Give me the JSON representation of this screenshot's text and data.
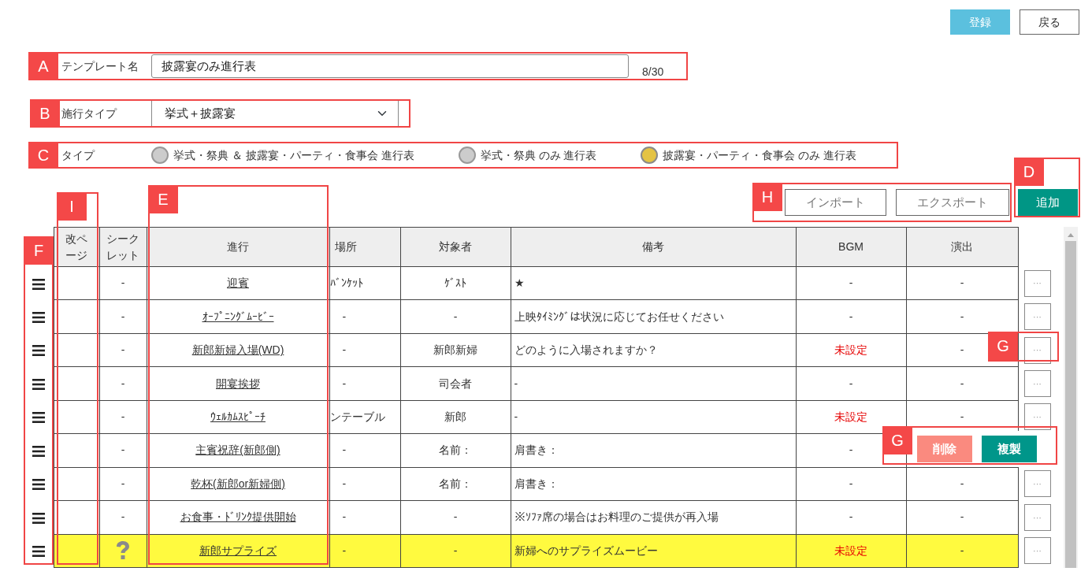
{
  "header_buttons": [
    {
      "label": "登録",
      "kind": "primary"
    },
    {
      "label": "戻る",
      "kind": "outline"
    }
  ],
  "template_name": {
    "label": "テンプレート名",
    "value": "披露宴のみ進行表",
    "count": "8/30"
  },
  "ceremony_type": {
    "label": "施行タイプ",
    "value": "挙式＋披露宴"
  },
  "type": {
    "label": "タイプ",
    "options": [
      {
        "label": "挙式・祭典 ＆ 披露宴・パーティ・食事会 進行表",
        "selected": false
      },
      {
        "label": "挙式・祭典 のみ 進行表",
        "selected": false
      },
      {
        "label": "披露宴・パーティ・食事会 のみ 進行表",
        "selected": true
      }
    ]
  },
  "import_buttons": [
    "インポート",
    "エクスポート"
  ],
  "add_button": "追加",
  "table": {
    "columns": [
      "改ページ",
      "シークレット",
      "進行",
      "場所",
      "対象者",
      "備考",
      "BGM",
      "演出"
    ],
    "rows": [
      {
        "secret": "-",
        "secret_icon": false,
        "progress": "迎賓",
        "place": "ﾊﾞﾝｹｯﾄ",
        "target": "ｹﾞｽﾄ",
        "note": "★",
        "bgm": "-",
        "bgm_unset": false,
        "effect": "-",
        "highlighted": false,
        "actions_open": false
      },
      {
        "secret": "-",
        "secret_icon": false,
        "progress": "ｵｰﾌﾟﾆﾝｸﾞﾑｰﾋﾞｰ",
        "place": "-",
        "target": "-",
        "note": "上映ﾀｲﾐﾝｸﾞは状況に応じてお任せください",
        "bgm": "-",
        "bgm_unset": false,
        "effect": "-",
        "highlighted": false,
        "actions_open": false
      },
      {
        "secret": "-",
        "secret_icon": false,
        "progress": "新郎新婦入場(WD)",
        "place": "-",
        "target": "新郎新婦",
        "note": "どのように入場されますか？",
        "bgm": "未設定",
        "bgm_unset": true,
        "effect": "-",
        "highlighted": false,
        "actions_open": false
      },
      {
        "secret": "-",
        "secret_icon": false,
        "progress": "開宴挨拶",
        "place": "-",
        "target": "司会者",
        "note": "-",
        "bgm": "-",
        "bgm_unset": false,
        "effect": "-",
        "highlighted": false,
        "actions_open": false
      },
      {
        "secret": "-",
        "secret_icon": false,
        "progress": "ｳｪﾙｶﾑｽﾋﾟｰﾁ",
        "place": "ンテーブル",
        "target": "新郎",
        "note": "-",
        "bgm": "未設定",
        "bgm_unset": true,
        "effect": "-",
        "highlighted": false,
        "actions_open": false
      },
      {
        "secret": "-",
        "secret_icon": false,
        "progress": "主賓祝辞(新郎側)",
        "place": "-",
        "target": "名前：",
        "note": "肩書き：",
        "bgm": "-",
        "bgm_unset": false,
        "highlighted": false,
        "actions_open": true
      },
      {
        "secret": "-",
        "secret_icon": false,
        "progress": "乾杯(新郎or新婦側)",
        "place": "-",
        "target": "名前：",
        "note": "肩書き：",
        "bgm": "-",
        "bgm_unset": false,
        "effect": "-",
        "highlighted": false,
        "actions_open": false
      },
      {
        "secret": "-",
        "secret_icon": false,
        "progress": "お食事・ﾄﾞﾘﾝｸ提供開始",
        "place": "-",
        "target": "-",
        "note": "※ｿﾌｧ席の場合はお料理のご提供が再入場",
        "bgm": "-",
        "bgm_unset": false,
        "effect": "-",
        "highlighted": false,
        "actions_open": false
      },
      {
        "secret_icon": true,
        "progress": "新郎サプライズ",
        "place": "-",
        "target": "-",
        "note": "新婦へのサプライズムービー",
        "bgm": "未設定",
        "bgm_unset": true,
        "effect": "-",
        "highlighted": true,
        "actions_open": false
      }
    ]
  },
  "row_menu_label": "···",
  "row_actions": {
    "buttons": [
      {
        "label": "削除",
        "kind": "delete"
      },
      {
        "label": "複製",
        "kind": "copy"
      }
    ]
  },
  "annotations": [
    {
      "letter": "A"
    },
    {
      "letter": "B"
    },
    {
      "letter": "C"
    },
    {
      "letter": "D"
    },
    {
      "letter": "H"
    },
    {
      "letter": "I"
    },
    {
      "letter": "E"
    },
    {
      "letter": "F"
    },
    {
      "letter": "G"
    },
    {
      "letter": "G"
    }
  ]
}
